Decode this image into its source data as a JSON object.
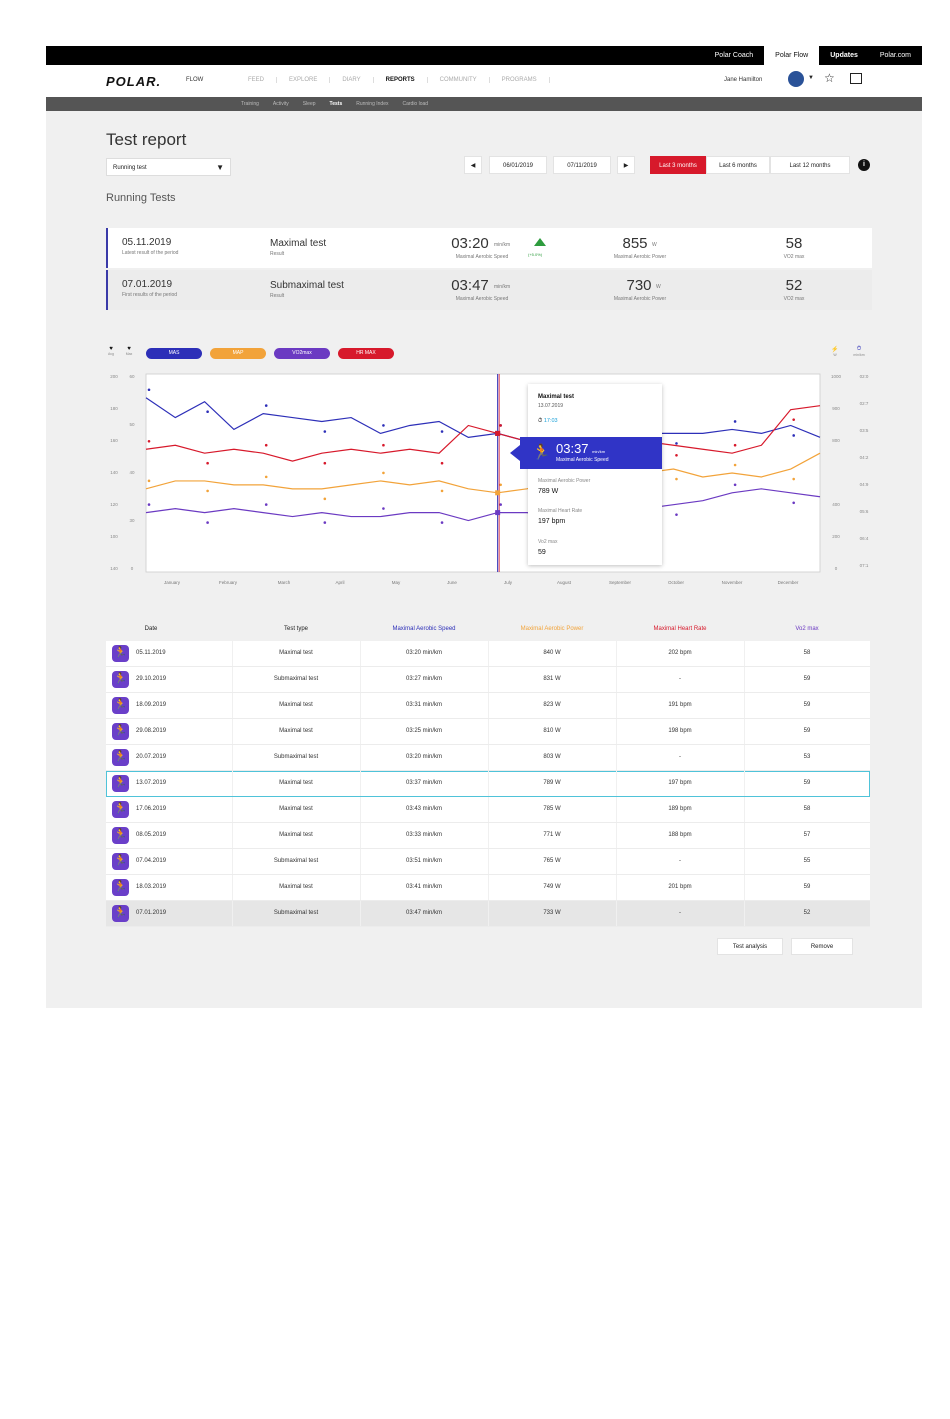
{
  "topbar": {
    "links": [
      "Polar Coach",
      "Polar Flow",
      "Updates",
      "Polar.com"
    ]
  },
  "nav": {
    "logo": "POLAR.",
    "flow": "FLOW",
    "items": [
      "FEED",
      "EXPLORE",
      "DIARY",
      "REPORTS",
      "COMMUNITY",
      "PROGRAMS"
    ],
    "active": "REPORTS",
    "user": "Jane Hamilton"
  },
  "subnav": {
    "items": [
      "Training",
      "Activity",
      "Sleep",
      "Tests",
      "Running Index",
      "Cardio load"
    ],
    "active": "Tests"
  },
  "page": {
    "title": "Test report",
    "select": "Running test",
    "section": "Running Tests",
    "date_from": "06/01/2019",
    "date_to": "07/11/2019",
    "ranges": [
      "Last 3 months",
      "Last 6 months",
      "Last 12 months"
    ],
    "info": "i"
  },
  "summary": [
    {
      "date": "05.11.2019",
      "date_sub": "Latest result of the period",
      "type": "Maximal test",
      "type_sub": "Result",
      "speed": "03:20",
      "speed_unit": "min/km",
      "speed_label": "Maximal Aerobic Speed",
      "change": "(+5.0%)",
      "power": "855",
      "power_unit": "W",
      "power_label": "Maximal Aerobic Power",
      "vo2": "58",
      "vo2_label": "VO2 max"
    },
    {
      "date": "07.01.2019",
      "date_sub": "First results of the period",
      "type": "Submaximal test",
      "type_sub": "Result",
      "speed": "03:47",
      "speed_unit": "min/km",
      "speed_label": "Maximal Aerobic Speed",
      "power": "730",
      "power_unit": "W",
      "power_label": "Maximal Aerobic Power",
      "vo2": "52",
      "vo2_label": "VO2 max"
    }
  ],
  "legend": {
    "pills": [
      {
        "label": "MAS",
        "color": "#2d2fb8"
      },
      {
        "label": "MAP",
        "color": "#f2a33a"
      },
      {
        "label": "VO2max",
        "color": "#6b3ac2"
      },
      {
        "label": "HR MAX",
        "color": "#d7192b"
      }
    ],
    "left_icons": [
      {
        "glyph": "♥",
        "label": "Avg"
      },
      {
        "glyph": "♥",
        "label": "Max"
      }
    ],
    "right_icons": [
      {
        "glyph": "⚡",
        "label": "W"
      },
      {
        "glyph": "⏱",
        "label": "min/km"
      }
    ]
  },
  "chart_data": {
    "type": "line",
    "x": [
      "January",
      "February",
      "March",
      "April",
      "May",
      "June",
      "July",
      "August",
      "September",
      "October",
      "November",
      "December"
    ],
    "series": [
      {
        "name": "MAS",
        "color": "#2d2fb8",
        "values": [
          0.88,
          0.78,
          0.86,
          0.72,
          0.8,
          0.78,
          0.76,
          0.78,
          0.7,
          0.74,
          0.76,
          0.68,
          0.7,
          0.66,
          0.7,
          0.74,
          0.68,
          0.7,
          0.7,
          0.7,
          0.72,
          0.7,
          0.74,
          0.68
        ]
      },
      {
        "name": "HR MAX",
        "color": "#d7192b",
        "values": [
          0.62,
          0.64,
          0.6,
          0.62,
          0.6,
          0.56,
          0.6,
          0.62,
          0.6,
          0.62,
          0.6,
          0.74,
          0.7,
          0.66,
          0.68,
          0.62,
          0.64,
          0.66,
          0.64,
          0.62,
          0.6,
          0.64,
          0.82,
          0.84
        ]
      },
      {
        "name": "MAP",
        "color": "#f2a33a",
        "values": [
          0.42,
          0.46,
          0.46,
          0.44,
          0.44,
          0.42,
          0.42,
          0.44,
          0.46,
          0.44,
          0.46,
          0.42,
          0.4,
          0.42,
          0.46,
          0.44,
          0.46,
          0.5,
          0.52,
          0.48,
          0.5,
          0.48,
          0.52,
          0.6
        ]
      },
      {
        "name": "VO2max",
        "color": "#6b3ac2",
        "values": [
          0.3,
          0.32,
          0.3,
          0.32,
          0.3,
          0.28,
          0.3,
          0.28,
          0.28,
          0.3,
          0.3,
          0.26,
          0.3,
          0.3,
          0.28,
          0.34,
          0.36,
          0.32,
          0.34,
          0.36,
          0.4,
          0.42,
          0.4,
          0.38
        ]
      }
    ],
    "left_axis_1": [
      "200",
      "180",
      "160",
      "140",
      "120",
      "100",
      "140"
    ],
    "left_axis_2": [
      "60",
      "",
      "50",
      "",
      "40",
      "",
      "30",
      "",
      "0"
    ],
    "right_axis_1": [
      "1000",
      "900",
      "800",
      "",
      "400",
      "200",
      "0"
    ],
    "right_axis_2": [
      "02:0",
      "02:7",
      "03:5",
      "04:2",
      "04:9",
      "05:6",
      "06:4",
      "07:1"
    ],
    "grid": false,
    "selected_index": 12
  },
  "tooltip": {
    "title": "Maximal test",
    "date": "13.07.2019",
    "time": "17:03",
    "speed": "03:37",
    "speed_unit": "min/km",
    "speed_label": "Maximal Aerobic Speed",
    "power_label": "Maximal Aerobic Power",
    "power": "789 W",
    "hr_label": "Maximal Heart Rate",
    "hr": "197 bpm",
    "vo2_label": "Vo2 max",
    "vo2": "59"
  },
  "table": {
    "headers": [
      {
        "label": "Date",
        "color": "#333333"
      },
      {
        "label": "Test type",
        "color": "#333333"
      },
      {
        "label": "Maximal Aerobic Speed",
        "color": "#2d2fb8"
      },
      {
        "label": "Maximal Aerobic Power",
        "color": "#f2a33a"
      },
      {
        "label": "Maximal Heart Rate",
        "color": "#d7192b"
      },
      {
        "label": "Vo2 max",
        "color": "#6b3ac2"
      }
    ],
    "rows": [
      [
        "05.11.2019",
        "Maximal test",
        "03:20 min/km",
        "840 W",
        "202 bpm",
        "58"
      ],
      [
        "29.10.2019",
        "Submaximal test",
        "03:27 min/km",
        "831 W",
        "-",
        "59"
      ],
      [
        "18.09.2019",
        "Maximal test",
        "03:31 min/km",
        "823 W",
        "191 bpm",
        "59"
      ],
      [
        "29.08.2019",
        "Maximal test",
        "03:25 min/km",
        "810 W",
        "198 bpm",
        "59"
      ],
      [
        "20.07.2019",
        "Submaximal test",
        "03:20 min/km",
        "803 W",
        "-",
        "53"
      ],
      [
        "13.07.2019",
        "Maximal test",
        "03:37 min/km",
        "789 W",
        "197 bpm",
        "59"
      ],
      [
        "17.06.2019",
        "Maximal test",
        "03:43 min/km",
        "785 W",
        "189 bpm",
        "58"
      ],
      [
        "08.05.2019",
        "Maximal test",
        "03:33 min/km",
        "771 W",
        "188 bpm",
        "57"
      ],
      [
        "07.04.2019",
        "Submaximal test",
        "03:51 min/km",
        "765 W",
        "-",
        "55"
      ],
      [
        "18.03.2019",
        "Maximal test",
        "03:41 min/km",
        "749 W",
        "201 bpm",
        "59"
      ],
      [
        "07.01.2019",
        "Submaximal test",
        "03:47 min/km",
        "733 W",
        "-",
        "52"
      ]
    ],
    "selected_row": 5,
    "buttons": [
      "Test analysis",
      "Remove"
    ]
  }
}
